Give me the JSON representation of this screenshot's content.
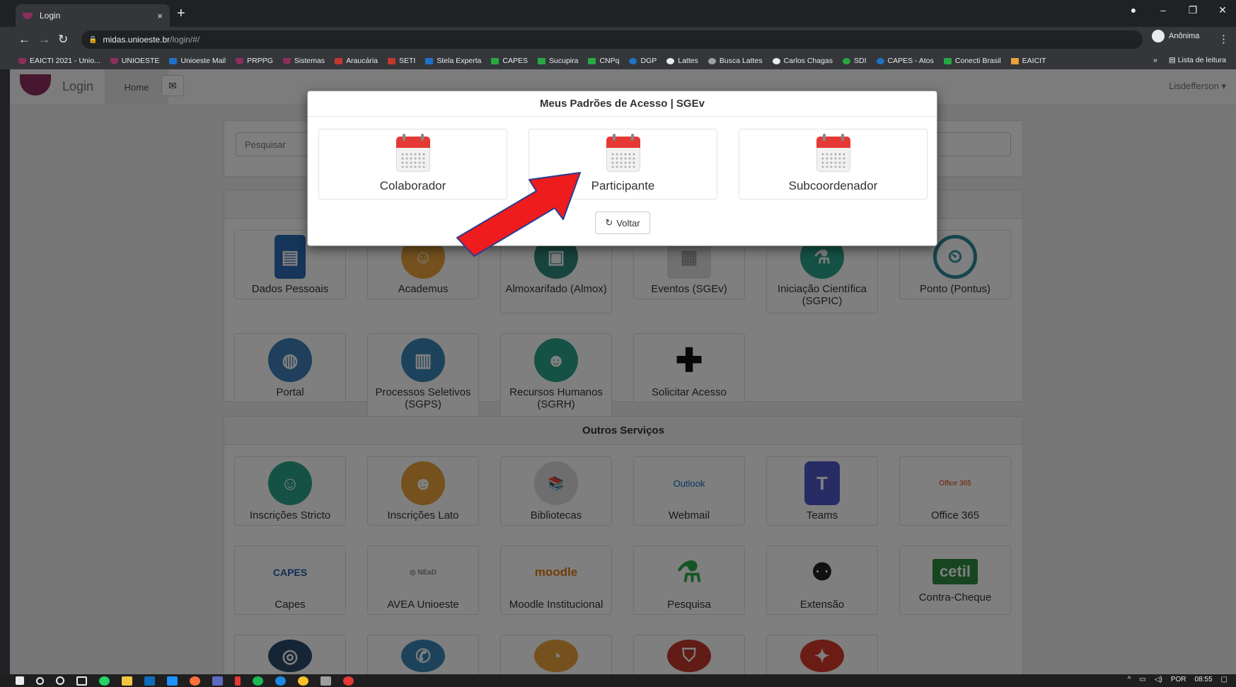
{
  "browser": {
    "tab_title": "Login",
    "tab_close": "×",
    "new_tab": "+",
    "url_host": "midas.unioeste.br",
    "url_path": "/login/#/",
    "profile_label": "Anônima",
    "bookmarks": [
      "EAICTI 2021 - Unio...",
      "UNIOESTE",
      "Unioeste Mail",
      "PRPPG",
      "Sistemas",
      "Araucária",
      "SETI",
      "Stela Experta",
      "CAPES",
      "Sucupira",
      "CNPq",
      "DGP",
      "Lattes",
      "Busca Lattes",
      "Carlos Chagas",
      "SDI",
      "CAPES - Atos",
      "Conecti Brasil",
      "EAICIT"
    ],
    "bookmarks_more": "»",
    "reading_list": "Lista de leitura"
  },
  "navbar": {
    "brand": "Login",
    "home": "Home",
    "user": "Lisdefferson ▾"
  },
  "search": {
    "placeholder": "Pesquisar"
  },
  "apps": {
    "items": [
      {
        "label": "Dados Pessoais",
        "color": "#2d6bb5"
      },
      {
        "label": "Academus",
        "color": "#e9a23b"
      },
      {
        "label": "Almoxarifado (Almox)",
        "color": "#2e8b7a"
      },
      {
        "label": "Eventos (SGEv)",
        "color": "#e0e0e0"
      },
      {
        "label": "Iniciação Científica (SGPIC)",
        "color": "#2aa58a"
      },
      {
        "label": "Ponto (Pontus)",
        "color": "#2a8a9a"
      },
      {
        "label": "Portal",
        "color": "#3f7fb8"
      },
      {
        "label": "Processos Seletivos (SGPS)",
        "color": "#3b86b8"
      },
      {
        "label": "Recursos Humanos (SGRH)",
        "color": "#2aa58a"
      },
      {
        "label": "Solicitar Acesso",
        "color": "#ffffff"
      }
    ]
  },
  "services": {
    "title": "Outros Serviços",
    "items": [
      {
        "label": "Inscrições Stricto",
        "color": "#2aa58a"
      },
      {
        "label": "Inscrições Lato",
        "color": "#e9a23b"
      },
      {
        "label": "Bibliotecas",
        "color": "#dcdcdc"
      },
      {
        "label": "Webmail",
        "color": "#ffffff"
      },
      {
        "label": "Teams",
        "color": "#5058c8"
      },
      {
        "label": "Office 365",
        "color": "#ffffff"
      },
      {
        "label": "Capes",
        "color": "#ffffff"
      },
      {
        "label": "AVEA Unioeste",
        "color": "#ffffff"
      },
      {
        "label": "Moodle Institucional",
        "color": "#ffffff"
      },
      {
        "label": "Pesquisa",
        "color": "#ffffff"
      },
      {
        "label": "Extensão",
        "color": "#ffffff"
      },
      {
        "label": "Contra-Cheque",
        "color": "#ffffff"
      }
    ],
    "logo_texts": {
      "webmail": "Outlook",
      "office": "Office 365",
      "capes": "CAPES",
      "moodle": "moodle",
      "cetil": "cetil",
      "teams": "T"
    }
  },
  "modal": {
    "title": "Meus Padrões de Acesso | SGEv",
    "roles": [
      "Colaborador",
      "Participante",
      "Subcoordenador"
    ],
    "back_label": "Voltar",
    "back_icon": "↻"
  },
  "taskbar": {
    "lang": "POR",
    "time": "08:55"
  },
  "colors": {
    "accent": "#8c2f5c",
    "arrow": "#ee1c1c",
    "calendar_red": "#e53935"
  }
}
